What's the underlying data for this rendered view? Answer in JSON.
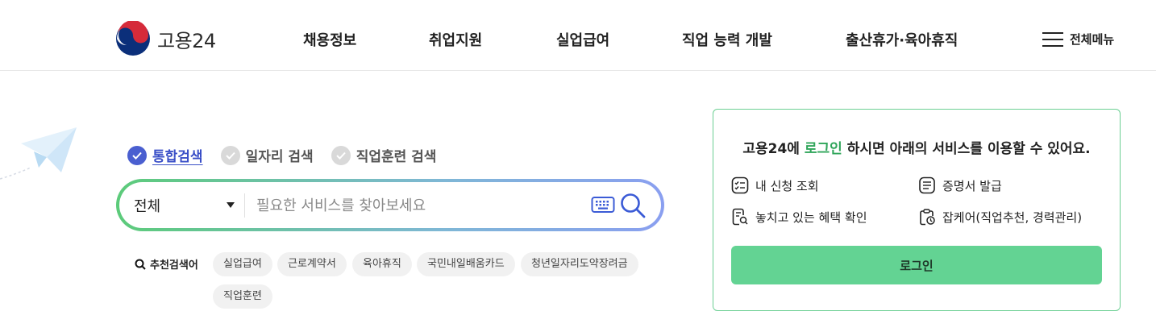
{
  "header": {
    "logo_text": "고용24",
    "nav": [
      "채용정보",
      "취업지원",
      "실업급여",
      "직업 능력 개발",
      "출산휴가·육아휴직"
    ],
    "all_menu_label": "전체메뉴"
  },
  "search": {
    "tabs": [
      {
        "label": "통합검색",
        "active": true
      },
      {
        "label": "일자리 검색",
        "active": false
      },
      {
        "label": "직업훈련 검색",
        "active": false
      }
    ],
    "category_selected": "전체",
    "placeholder": "필요한 서비스를 찾아보세요",
    "recommend_title": "추천검색어",
    "keywords": [
      "실업급여",
      "근로계약서",
      "육아휴직",
      "국민내일배움카드",
      "청년일자리도약장려금",
      "직업훈련"
    ]
  },
  "login_card": {
    "msg_prefix": "고용24에 ",
    "msg_highlight": "로그인",
    "msg_suffix": " 하시면 아래의 서비스를 이용할 수 있어요.",
    "services": [
      "내 신청 조회",
      "증명서 발급",
      "놓치고 있는 혜택 확인",
      "잡케어(직업추천, 경력관리)"
    ],
    "button_label": "로그인"
  },
  "colors": {
    "brand_green": "#63d393",
    "active_tab": "#3a4fc7",
    "highlight_text": "#2fa55a"
  }
}
